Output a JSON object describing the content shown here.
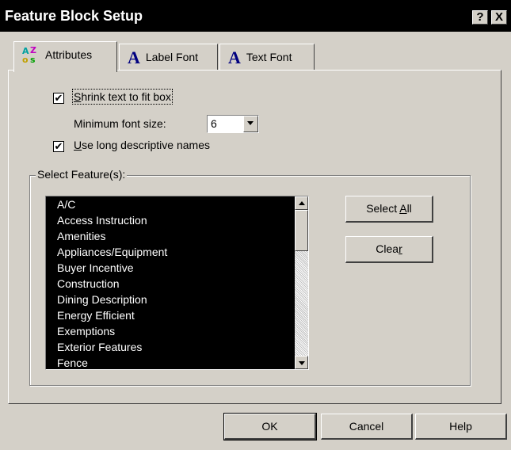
{
  "window": {
    "title": "Feature Block Setup",
    "help_glyph": "?",
    "close_glyph": "X"
  },
  "tabs": [
    {
      "label": "Attributes",
      "icon": "sort-az-icon",
      "active": true
    },
    {
      "label": "Label Font",
      "icon": "font-a-icon",
      "active": false
    },
    {
      "label": "Text Font",
      "icon": "font-a-icon",
      "active": false
    }
  ],
  "tab_icon_letters": {
    "a": "A",
    "z": "Z",
    "o": "o",
    "s": "s",
    "font_a": "A"
  },
  "options": {
    "shrink_text": {
      "label_accel": "S",
      "label_rest": "hrink text to fit box",
      "checked": true
    },
    "min_font": {
      "label": "Minimum font size:",
      "value": "6"
    },
    "long_names": {
      "label_accel": "U",
      "label_rest": "se long descriptive names",
      "checked": true
    }
  },
  "check_glyph": "✔",
  "features_group": {
    "label": "Select Feature(s):",
    "items": [
      "A/C",
      "Access Instruction",
      "Amenities",
      "Appliances/Equipment",
      "Buyer Incentive",
      "Construction",
      "Dining Description",
      "Energy Efficient",
      "Exemptions",
      "Exterior Features",
      "Fence"
    ]
  },
  "side_buttons": {
    "select_all": {
      "pre": "Select ",
      "accel": "A",
      "post": "ll"
    },
    "clear": {
      "pre": "Clea",
      "accel": "r",
      "post": ""
    }
  },
  "bottom_buttons": {
    "ok": "OK",
    "cancel": "Cancel",
    "help": "Help"
  },
  "colors": {
    "titlebar": "#000000",
    "dialog": "#d4d0c8",
    "list_selection": "#000000",
    "accent_icon": "#000080"
  }
}
